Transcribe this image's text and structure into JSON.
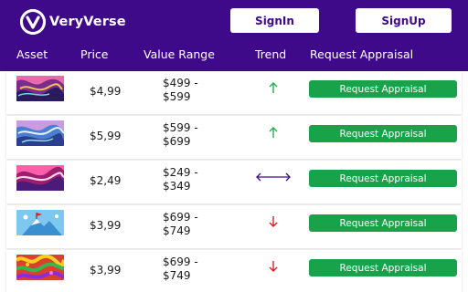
{
  "brand": {
    "name": "VeryVerse"
  },
  "auth": {
    "signin_label": "SignIn",
    "signup_label": "SignUp"
  },
  "colors": {
    "header_bg": "#3f0a8a",
    "button_green": "#18a34a",
    "trend_up": "#22b14c",
    "trend_down": "#e02020",
    "trend_neutral": "#3f0a8a"
  },
  "table": {
    "headers": {
      "asset": "Asset",
      "price": "Price",
      "range": "Value Range",
      "trend": "Trend",
      "request": "Request Appraisal"
    },
    "rows": [
      {
        "asset_icon": "abstract-art-thumbnail",
        "price": "$4,99",
        "range_low": "$499 -",
        "range_high": "$599",
        "trend": "up",
        "trend_icon": "arrow-up-icon",
        "button": "Request Appraisal"
      },
      {
        "asset_icon": "marble-swirl-thumbnail",
        "price": "$5,99",
        "range_low": "$599 -",
        "range_high": "$699",
        "trend": "up",
        "trend_icon": "arrow-up-icon",
        "button": "Request Appraisal"
      },
      {
        "asset_icon": "pink-wave-thumbnail",
        "price": "$2,49",
        "range_low": "$249 -",
        "range_high": "$349",
        "trend": "neutral",
        "trend_icon": "arrow-left-right-icon",
        "button": "Request Appraisal"
      },
      {
        "asset_icon": "mountain-flag-thumbnail",
        "price": "$3,99",
        "range_low": "$699 -",
        "range_high": "$749",
        "trend": "down",
        "trend_icon": "arrow-down-icon",
        "button": "Request Appraisal"
      },
      {
        "asset_icon": "psychedelic-pattern-thumbnail",
        "price": "$3,99",
        "range_low": "$699 -",
        "range_high": "$749",
        "trend": "down",
        "trend_icon": "arrow-down-icon",
        "button": "Request Appraisal"
      }
    ]
  }
}
